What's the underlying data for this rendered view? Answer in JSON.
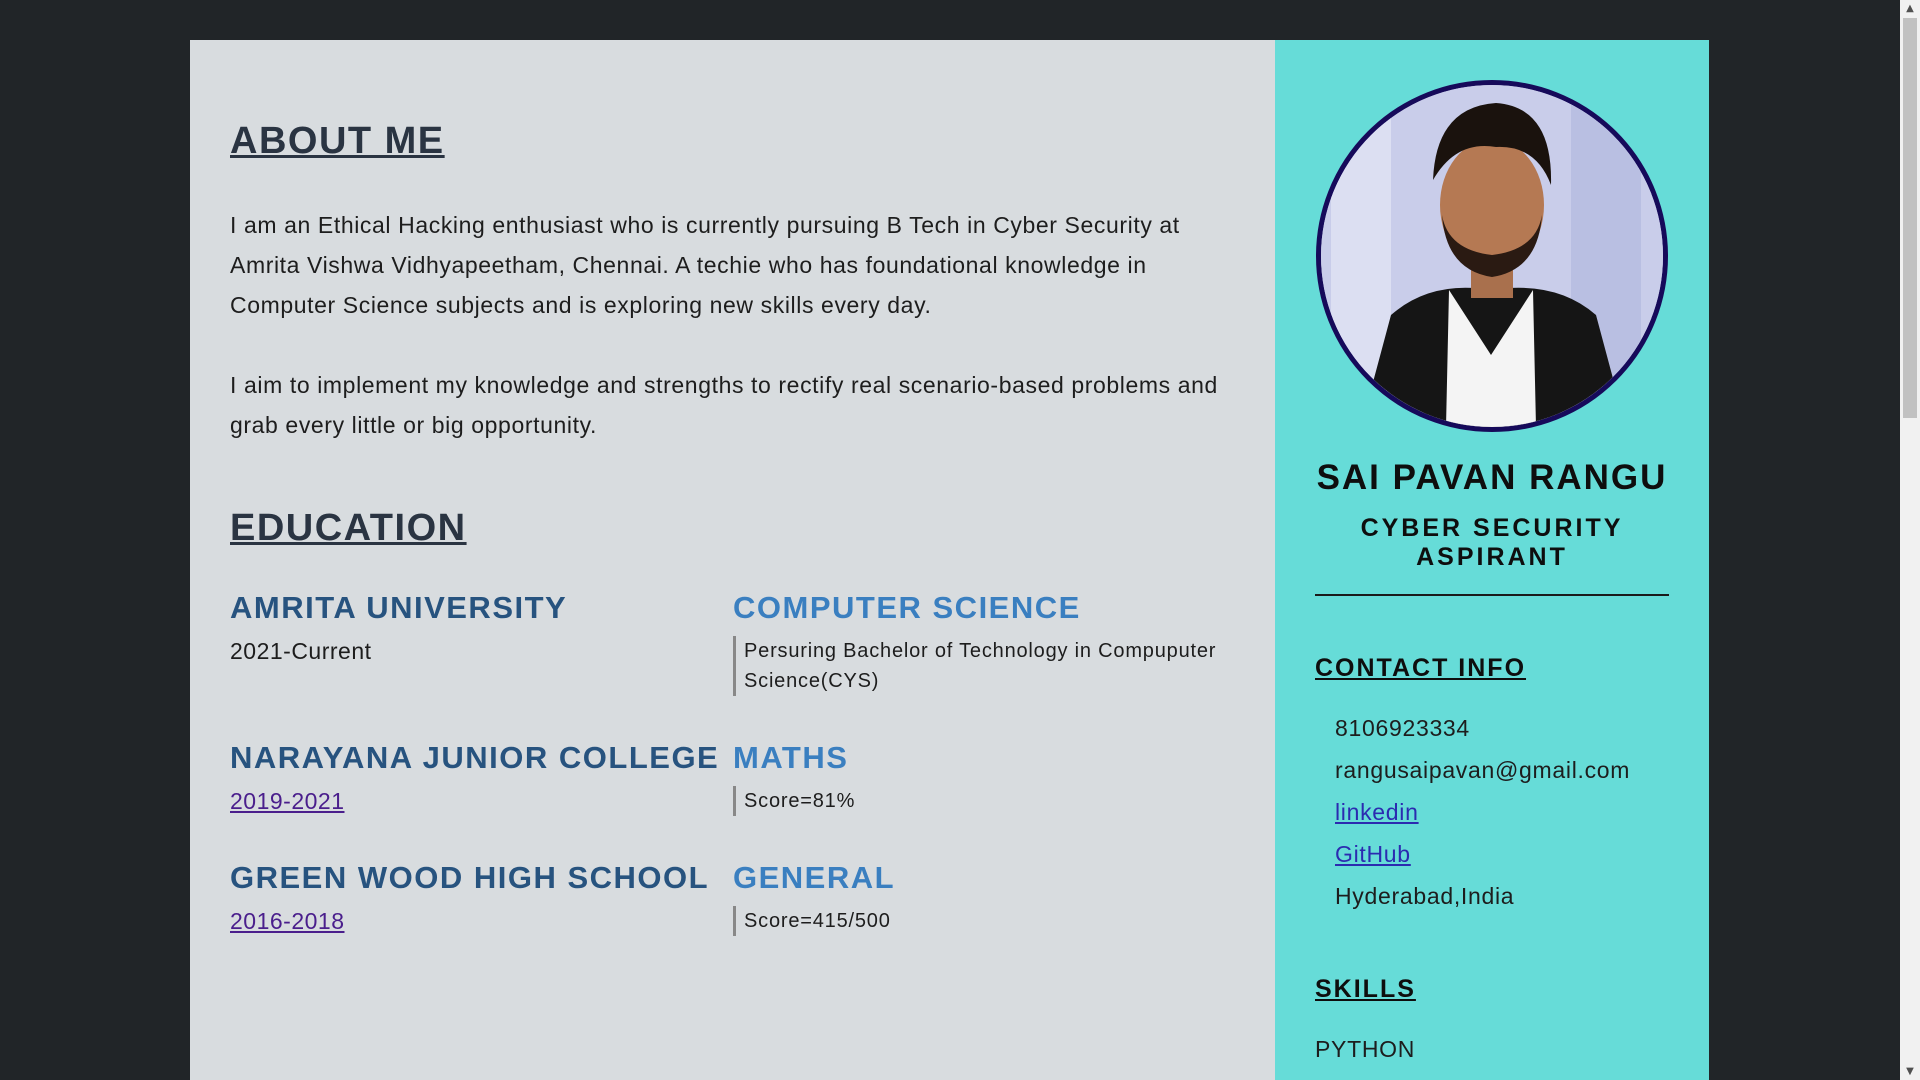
{
  "about": {
    "title": "ABOUT ME",
    "paragraphs": [
      "I am an Ethical Hacking enthusiast who is currently pursuing B Tech in Cyber Security at Amrita Vishwa Vidhyapeetham, Chennai. A techie who has foundational knowledge in Computer Science subjects and is exploring new skills every day.",
      "I aim to implement my knowledge and strengths to rectify real scenario-based problems and grab every little or big opportunity."
    ]
  },
  "education": {
    "title": "EDUCATION",
    "entries": [
      {
        "institution": "AMRITA UNIVERSITY",
        "years": "2021-Current",
        "subject": "COMPUTER SCIENCE",
        "details": "Persuring Bachelor of Technology in Compuputer Science(CYS)"
      },
      {
        "institution": "NARAYANA JUNIOR COLLEGE",
        "years": "2019-2021",
        "subject": "MATHS",
        "details": "Score=81%"
      },
      {
        "institution": "GREEN WOOD HIGH SCHOOL",
        "years": "2016-2018",
        "subject": "GENERAL",
        "details": "Score=415/500"
      }
    ]
  },
  "profile": {
    "name": "SAI PAVAN RANGU",
    "role": "CYBER SECURITY ASPIRANT"
  },
  "contact": {
    "title": "CONTACT INFO",
    "phone": "8106923334",
    "email": "rangusaipavan@gmail.com",
    "linkedin": "linkedin",
    "github": "GitHub",
    "location": "Hyderabad,India"
  },
  "skills": {
    "title": "SKILLS",
    "items": [
      "PYTHON"
    ]
  },
  "colors": {
    "background": "#212528",
    "main_panel": "#d8dcdf",
    "sidebar": "#66dcd8",
    "heading": "#2a3442",
    "institution": "#27537f",
    "subject": "#3a7fc0",
    "avatar_border": "#160a5a"
  },
  "icons": {
    "scroll_up": "scroll-up-arrow-icon",
    "scroll_down": "scroll-down-arrow-icon"
  }
}
